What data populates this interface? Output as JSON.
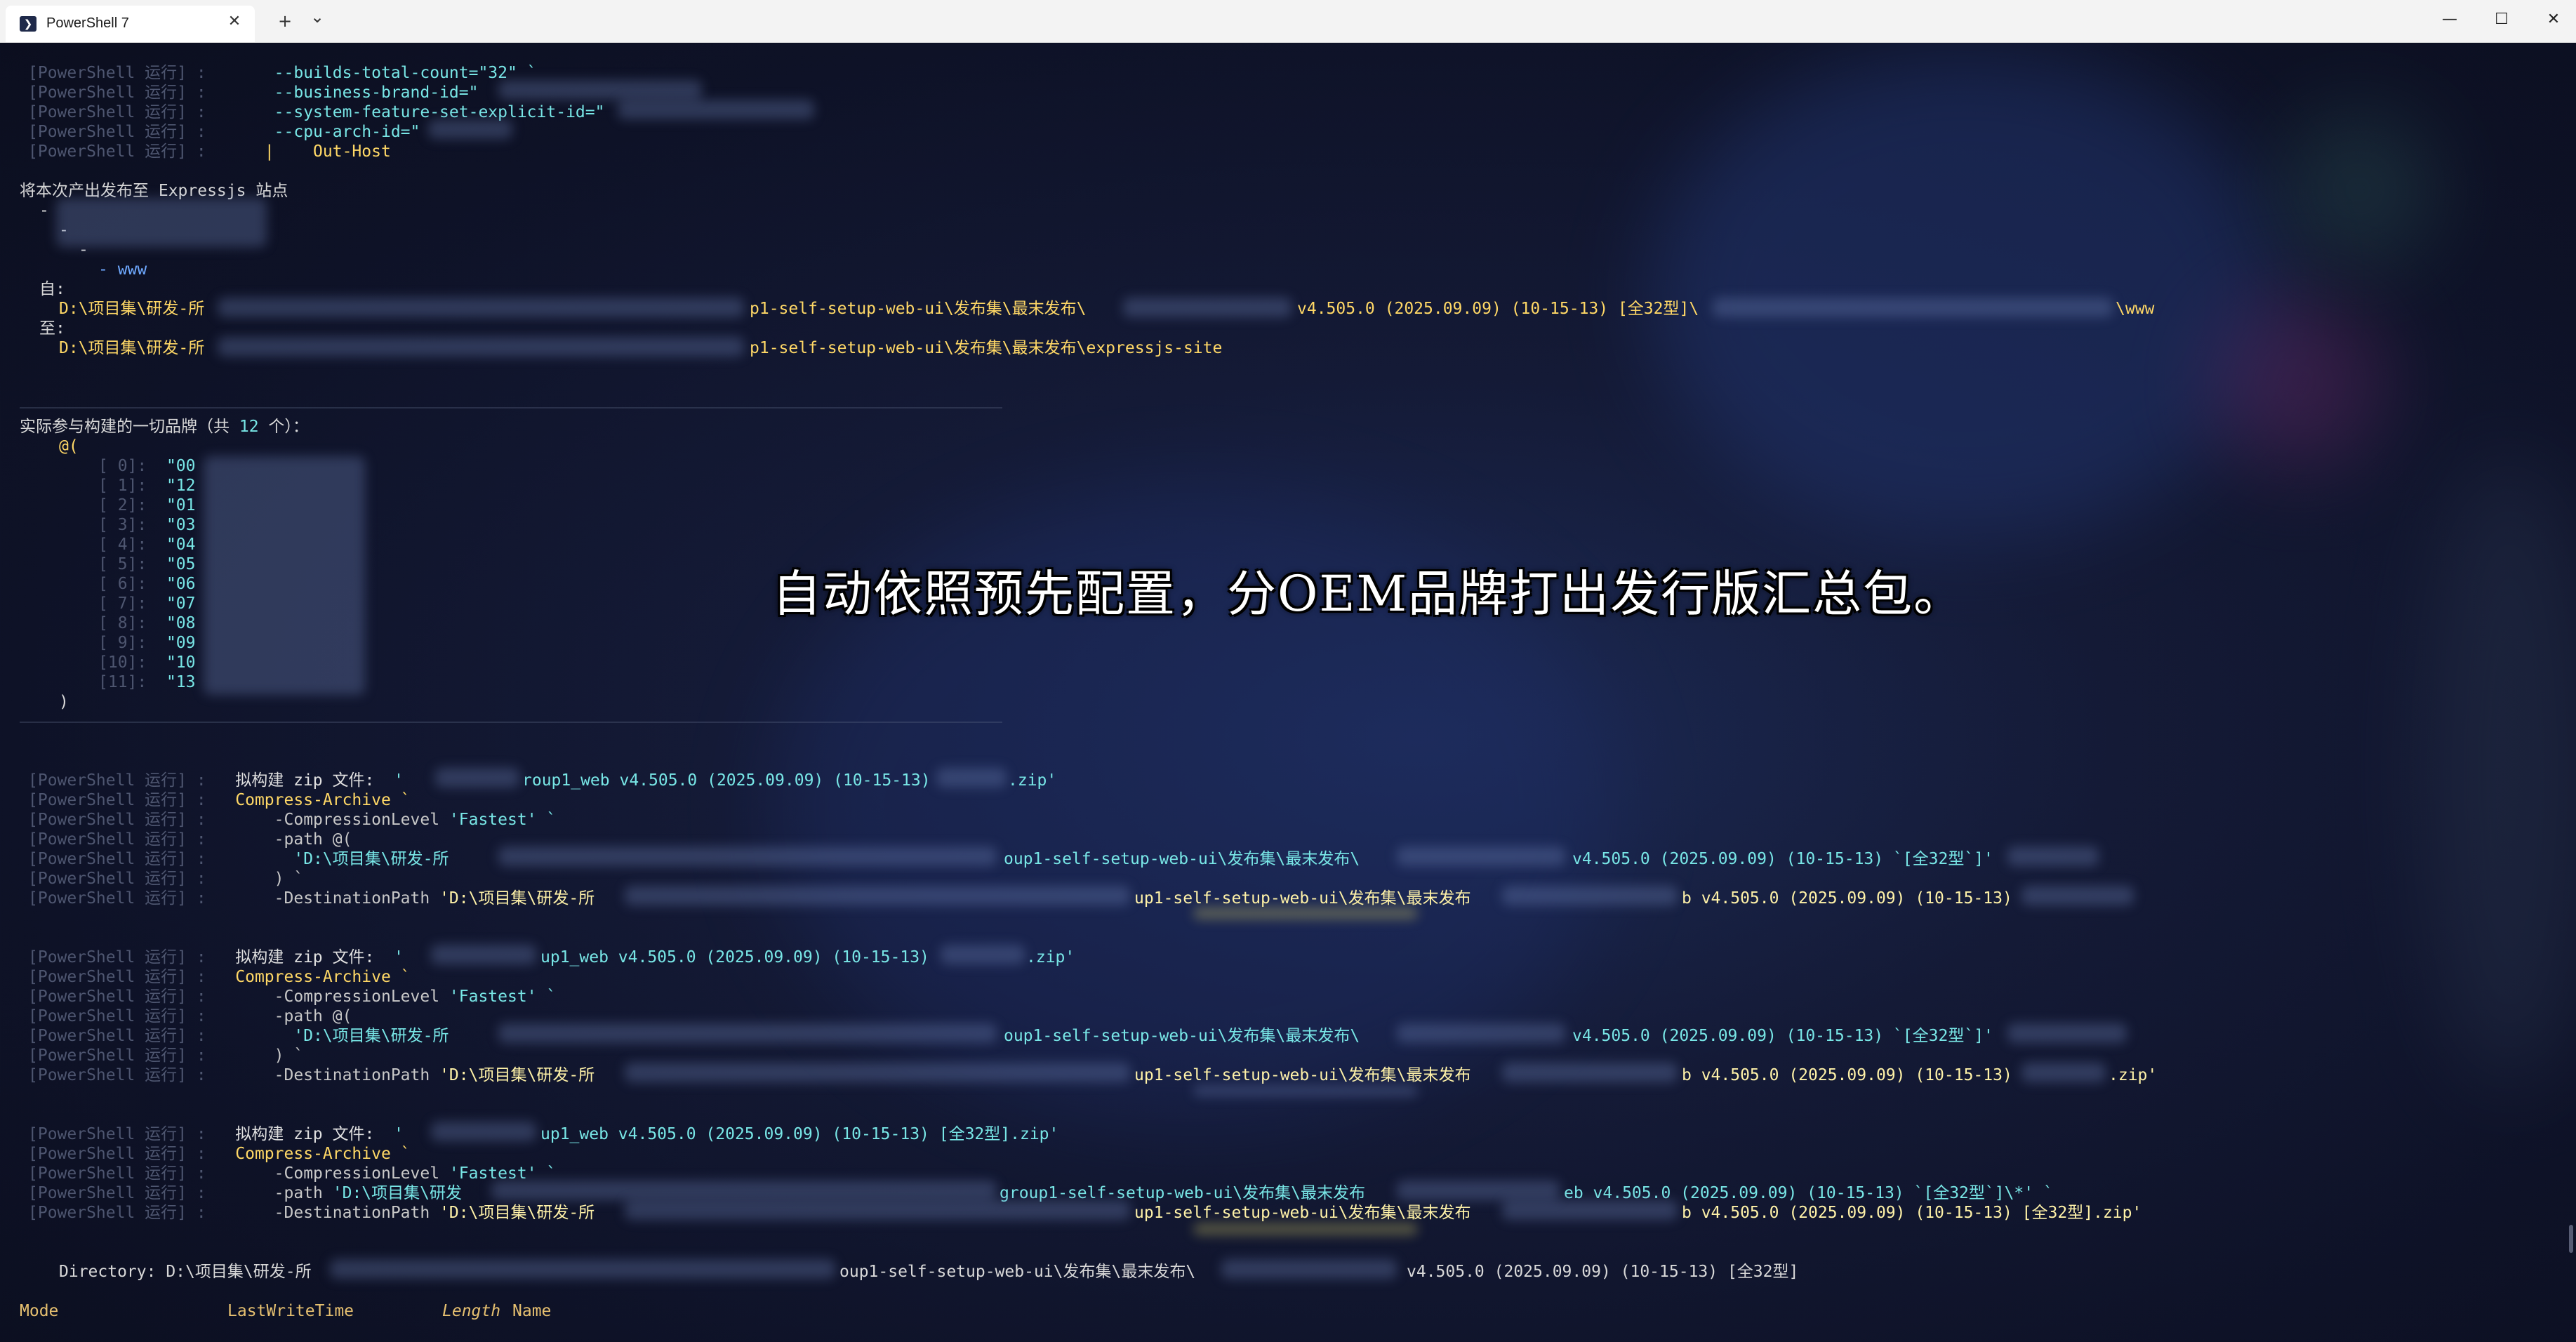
{
  "window": {
    "tab_title": "PowerShell 7",
    "icons": [
      "powershell-icon",
      "close-icon",
      "plus-icon",
      "chevron-down-icon",
      "minimize-icon",
      "maximize-icon",
      "window-close-icon"
    ]
  },
  "glyphs": {
    "tab_icon": "❯",
    "close": "✕",
    "new_tab": "+",
    "dropdown": "⌄",
    "minimize": "—",
    "maximize": "☐",
    "win_close": "✕"
  },
  "prefix": "[PowerShell 运行] :",
  "block1": [
    "--builds-total-count=\"32\" `",
    "--business-brand-id=\"",
    "--system-feature-set-explicit-id=\"",
    "--cpu-arch-id=\"",
    "|    Out-Host"
  ],
  "publish": {
    "heading": "将本次产出发布至 Expressjs 站点",
    "tree_dash1": "-",
    "tree_dash2": "-",
    "tree_dash3": "-",
    "tree_www": "- www",
    "from_label": "自:",
    "from_path_a": "D:\\项目集\\研发-所",
    "from_path_b": "p1-self-setup-web-ui\\发布集\\最末发布\\",
    "from_path_c": "v4.505.0 (2025.09.09) (10-15-13) [全32型]\\",
    "from_path_d": "\\www",
    "to_label": "至:",
    "to_path_a": "D:\\项目集\\研发-所",
    "to_path_b": "p1-self-setup-web-ui\\发布集\\最末发布\\expressjs-site"
  },
  "brands": {
    "heading_a": "实际参与构建的一切品牌（共 ",
    "count": "12",
    "heading_b": " 个）：",
    "open": "@(",
    "close": ")",
    "items": [
      {
        "idx": "[ 0]:",
        "val": "\"00"
      },
      {
        "idx": "[ 1]:",
        "val": "\"12"
      },
      {
        "idx": "[ 2]:",
        "val": "\"01"
      },
      {
        "idx": "[ 3]:",
        "val": "\"03"
      },
      {
        "idx": "[ 4]:",
        "val": "\"04"
      },
      {
        "idx": "[ 5]:",
        "val": "\"05"
      },
      {
        "idx": "[ 6]:",
        "val": "\"06"
      },
      {
        "idx": "[ 7]:",
        "val": "\"07"
      },
      {
        "idx": "[ 8]:",
        "val": "\"08"
      },
      {
        "idx": "[ 9]:",
        "val": "\"09"
      },
      {
        "idx": "[10]:",
        "val": "\"10"
      },
      {
        "idx": "[11]:",
        "val": "\"13"
      }
    ]
  },
  "caption": "自动依照预先配置，分OEM品牌打出发行版汇总包。",
  "zip1": {
    "label": "拟构建 zip 文件:",
    "name_a": "'",
    "name_b": "roup1_web v4.505.0 (2025.09.09) (10-15-13)",
    "name_c": ".zip'",
    "cmd": "Compress-Archive `",
    "level_param": "-CompressionLevel",
    "level_val": "'Fastest' `",
    "path_param": "-path @(",
    "path_a": "'D:\\项目集\\研发-所",
    "path_b": "oup1-self-setup-web-ui\\发布集\\最末发布\\",
    "path_c": "v4.505.0 (2025.09.09) (10-15-13) `[全32型`]'",
    "path_close": ") `",
    "dest_param": "-DestinationPath",
    "dest_a": "'D:\\项目集\\研发-所",
    "dest_b": "up1-self-setup-web-ui\\发布集\\最末发布",
    "dest_c": "b v4.505.0 (2025.09.09) (10-15-13)"
  },
  "zip2": {
    "label": "拟构建 zip 文件:",
    "name_a": "'",
    "name_b": "up1_web v4.505.0 (2025.09.09) (10-15-13)",
    "name_c": ".zip'",
    "cmd": "Compress-Archive `",
    "level_param": "-CompressionLevel",
    "level_val": "'Fastest' `",
    "path_param": "-path @(",
    "path_a": "'D:\\项目集\\研发-所",
    "path_b": "oup1-self-setup-web-ui\\发布集\\最末发布\\",
    "path_c": "v4.505.0 (2025.09.09) (10-15-13) `[全32型`]'",
    "path_close": ") `",
    "dest_param": "-DestinationPath",
    "dest_a": "'D:\\项目集\\研发-所",
    "dest_b": "up1-self-setup-web-ui\\发布集\\最末发布",
    "dest_c": "b v4.505.0 (2025.09.09) (10-15-13)",
    "dest_d": ".zip'"
  },
  "zip3": {
    "label": "拟构建 zip 文件:",
    "name_a": "'",
    "name_b": "up1_web v4.505.0 (2025.09.09) (10-15-13) [全32型].zip'",
    "cmd": "Compress-Archive `",
    "level_param": "-CompressionLevel",
    "level_val": "'Fastest' `",
    "path_param": "-path",
    "path_a": "'D:\\项目集\\研发",
    "path_b": "group1-self-setup-web-ui\\发布集\\最末发布",
    "path_c": "eb v4.505.0 (2025.09.09) (10-15-13) `[全32型`]\\*' `",
    "dest_param": "-DestinationPath",
    "dest_a": "'D:\\项目集\\研发-所",
    "dest_b": "up1-self-setup-web-ui\\发布集\\最末发布",
    "dest_c": "b v4.505.0 (2025.09.09) (10-15-13) [全32型].zip'"
  },
  "directory": {
    "label": "Directory: ",
    "path_a": "D:\\项目集\\研发-所",
    "path_b": "oup1-self-setup-web-ui\\发布集\\最末发布\\",
    "path_c": "v4.505.0 (2025.09.09) (10-15-13) [全32型]"
  },
  "table_header": {
    "mode": "Mode",
    "lastwrite": "LastWriteTime",
    "length": "Length",
    "name": "Name"
  }
}
